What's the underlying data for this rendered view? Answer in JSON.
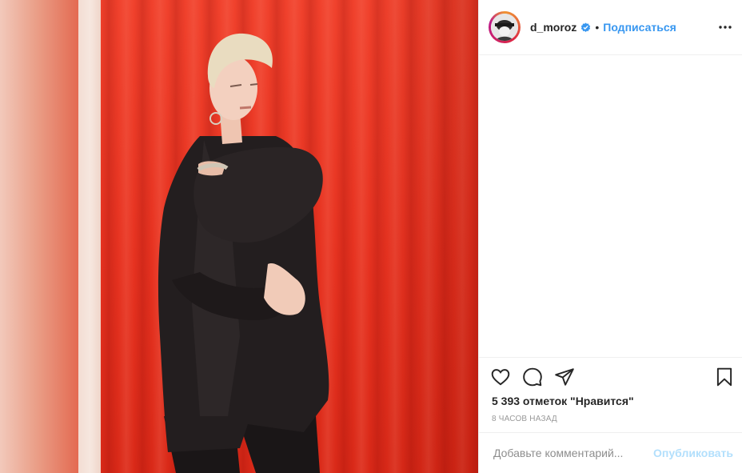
{
  "post": {
    "image_description_colors": {
      "curtain": "#e63220",
      "suit": "#1f1b1c"
    }
  },
  "header": {
    "username": "d_moroz",
    "separator": "•",
    "follow_label": "Подписаться",
    "verified_color": "#3897f0"
  },
  "actions": {
    "icons": [
      "heart-icon",
      "comment-icon",
      "share-icon",
      "bookmark-icon"
    ]
  },
  "likes": {
    "text": "5 393 отметок \"Нравится\""
  },
  "time": {
    "text": "8 часов назад"
  },
  "comment": {
    "placeholder": "Добавьте комментарий...",
    "publish_label": "Опубликовать"
  }
}
